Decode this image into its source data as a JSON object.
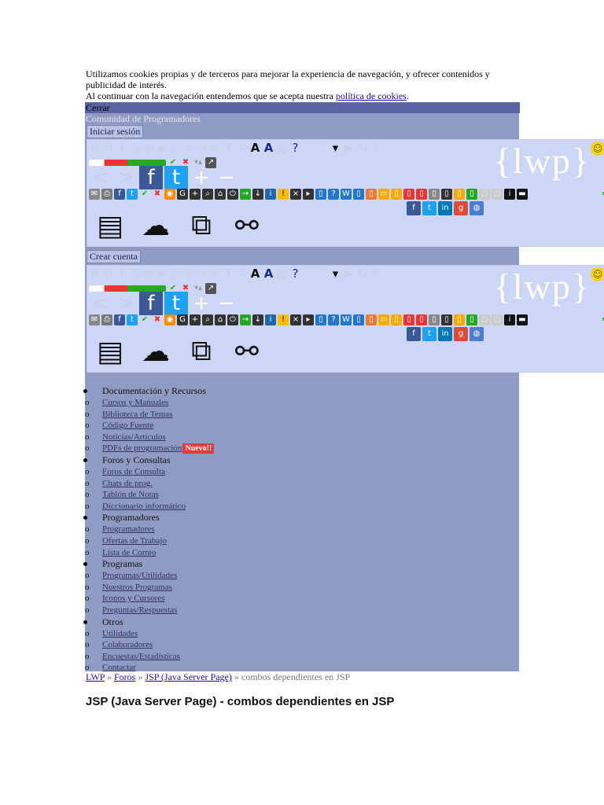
{
  "cookie": {
    "line1": "Utilizamos cookies propias y de terceros para mejorar la experiencia de navegación, y ofrecer contenidos y publicidad de interés.",
    "line2": "Al continuar con la navegación entendemos que se acepta nuestra",
    "policy_link": "política de cookies",
    "period": "."
  },
  "panel": {
    "close_label": "Cerrar",
    "subtitle": "Comunidad de Programadores",
    "login_button": "Iniciar sesión",
    "register_button": "Crear cuenta",
    "logo_text": "{lwp}"
  },
  "editor_icons": {
    "social_row": [
      "f",
      "t",
      "in",
      "g",
      "globe"
    ],
    "large_icons": [
      "document-icon",
      "cloud-upload-icon",
      "copy-link-icon",
      "link-icon"
    ]
  },
  "menu": [
    {
      "category": "Documentación y Recursos",
      "items": [
        "Cursos y Manuales",
        "Biblioteca de Temas",
        "Código Fuente",
        "Noticias/Artículos",
        "PDFs de programación"
      ]
    },
    {
      "category": "Foros y Consultas",
      "items": [
        "Foros de Consulta",
        "Chats de prog.",
        "Tablón de Notas",
        "Diccionario informático"
      ]
    },
    {
      "category": "Programadores",
      "items": [
        "Programadores",
        "Ofertas de Trabajo",
        "Lista de Correo"
      ]
    },
    {
      "category": "Programas",
      "items": [
        "Programas/Utilidades",
        "Nuestros Programas",
        "Iconos y Cursores",
        "Preguntas/Respuestas"
      ]
    },
    {
      "category": "Otros",
      "items": [
        "Utilidades",
        "Colaboradores",
        "Encuestas/Estadísticas",
        "Contactar"
      ]
    }
  ],
  "new_badge": "Nuevo!!",
  "breadcrumb": {
    "home": "LWP",
    "sep": "»",
    "forums": "Foros",
    "section": "JSP (Java Server Page)",
    "current": "combos dependientes en JSP"
  },
  "page_title": "JSP (Java Server Page) - combos dependientes en JSP",
  "colors": {
    "panel_bg": "#8f9bc2",
    "close_bar": "#5a64a0",
    "editor_bg": "#cdd6f5",
    "badge": "#e33b3b",
    "link": "#1a0dab"
  }
}
